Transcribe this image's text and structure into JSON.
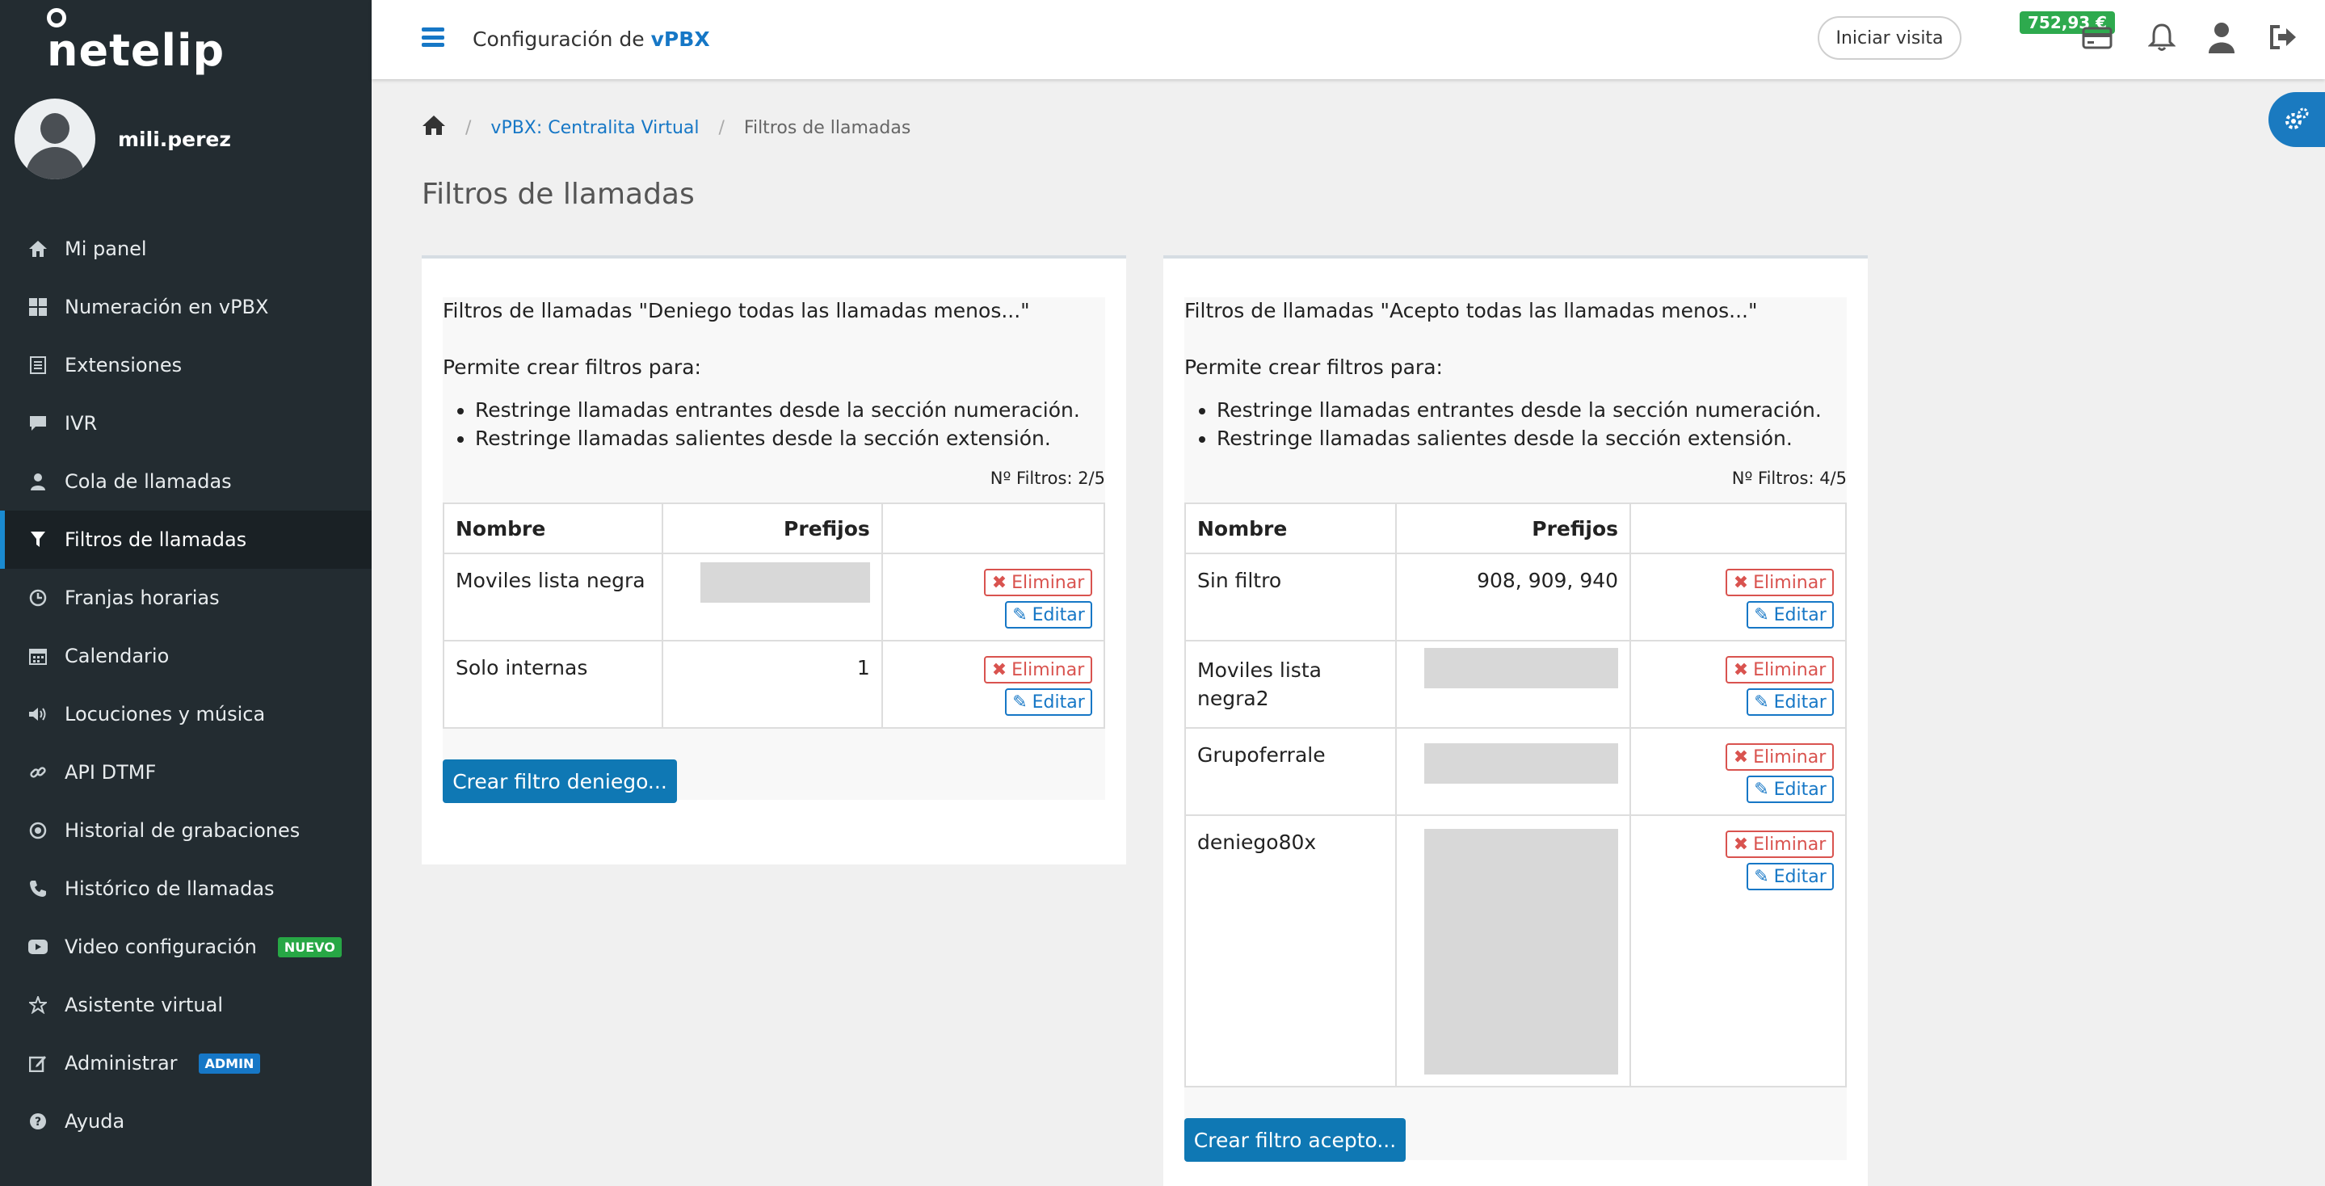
{
  "brand": {
    "name": "netelip"
  },
  "user": {
    "name": "mili.perez"
  },
  "sidebar": {
    "items": [
      {
        "label": "Mi panel",
        "icon": "home-icon"
      },
      {
        "label": "Numeración en vPBX",
        "icon": "grid-icon"
      },
      {
        "label": "Extensiones",
        "icon": "list-icon"
      },
      {
        "label": "IVR",
        "icon": "chat-icon"
      },
      {
        "label": "Cola de llamadas",
        "icon": "user-icon"
      },
      {
        "label": "Filtros de llamadas",
        "icon": "filter-icon",
        "active": true
      },
      {
        "label": "Franjas horarias",
        "icon": "clock-icon"
      },
      {
        "label": "Calendario",
        "icon": "calendar-icon"
      },
      {
        "label": "Locuciones y música",
        "icon": "volume-icon"
      },
      {
        "label": "API DTMF",
        "icon": "link-icon"
      },
      {
        "label": "Historial de grabaciones",
        "icon": "record-icon"
      },
      {
        "label": "Histórico de llamadas",
        "icon": "phone-icon"
      },
      {
        "label": "Video configuración",
        "icon": "video-icon",
        "badge": "NUEVO"
      },
      {
        "label": "Asistente virtual",
        "icon": "star-icon"
      },
      {
        "label": "Administrar",
        "icon": "edit-icon",
        "badge": "ADMIN"
      },
      {
        "label": "Ayuda",
        "icon": "help-icon"
      }
    ]
  },
  "topbar": {
    "title_prefix": "Configuración de",
    "title_brand": "vPBX",
    "visit_button": "Iniciar visita",
    "balance": "752,93 €"
  },
  "breadcrumb": {
    "link": "vPBX: Centralita Virtual",
    "current": "Filtros de llamadas"
  },
  "page": {
    "title": "Filtros de llamadas"
  },
  "columns": {
    "name": "Nombre",
    "prefixes": "Prefijos"
  },
  "actions": {
    "delete": "Eliminar",
    "edit": "Editar"
  },
  "deny_panel": {
    "title": "Filtros de llamadas \"Deniego todas las llamadas menos...\"",
    "desc": "Permite crear filtros para:",
    "bullets": [
      "Restringe llamadas entrantes desde la sección numeración.",
      "Restringe llamadas salientes desde la sección extensión."
    ],
    "count": "Nº Filtros: 2/5",
    "rows": [
      {
        "name": "Moviles lista negra",
        "prefix": ""
      },
      {
        "name": "Solo internas",
        "prefix": "1"
      }
    ],
    "create_button": "Crear filtro deniego..."
  },
  "accept_panel": {
    "title": "Filtros de llamadas \"Acepto todas las llamadas menos...\"",
    "desc": "Permite crear filtros para:",
    "bullets": [
      "Restringe llamadas entrantes desde la sección numeración.",
      "Restringe llamadas salientes desde la sección extensión."
    ],
    "count": "Nº Filtros: 4/5",
    "rows": [
      {
        "name": "Sin filtro",
        "prefix": "908, 909, 940"
      },
      {
        "name": "Moviles lista negra2",
        "prefix": ""
      },
      {
        "name": "Grupoferrale",
        "prefix": ""
      },
      {
        "name": "deniego80x",
        "prefix": ""
      }
    ],
    "create_button": "Crear filtro acepto..."
  }
}
